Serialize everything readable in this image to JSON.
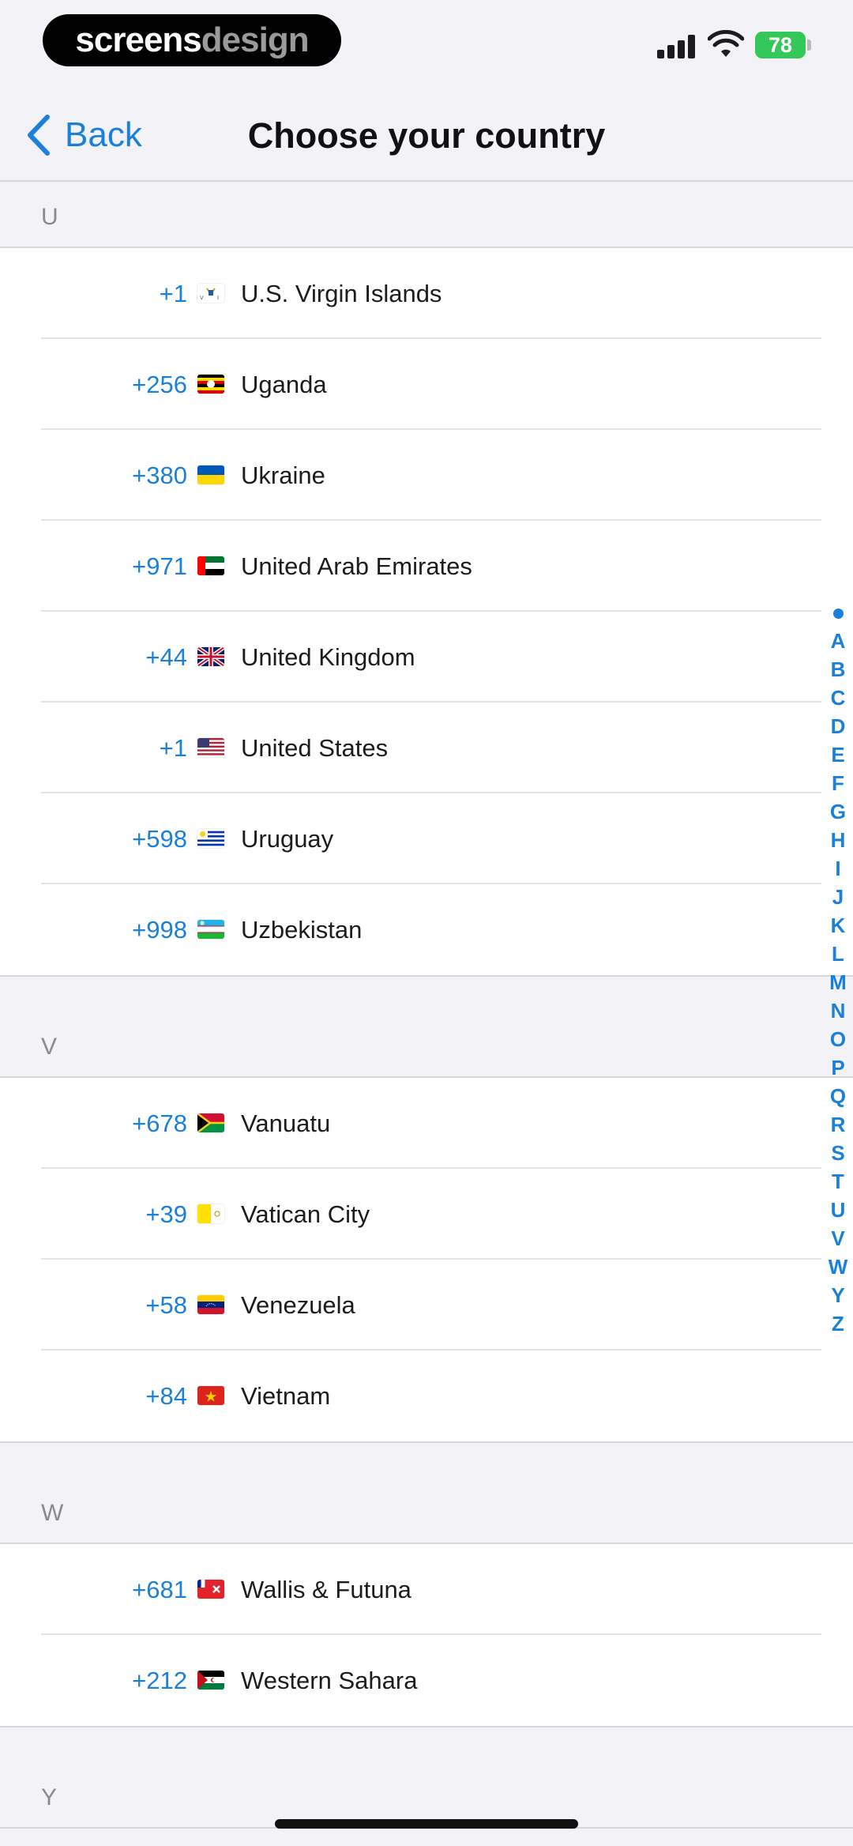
{
  "watermark": {
    "part1": "screens",
    "part2": "design"
  },
  "status": {
    "battery": "78"
  },
  "nav": {
    "back_label": "Back",
    "title": "Choose your country"
  },
  "colors": {
    "accent": "#1a80d9",
    "battery": "#34c759",
    "background": "#f2f2f7"
  },
  "sections": [
    {
      "letter": "U",
      "rows": [
        {
          "code": "+1",
          "name": "U.S. Virgin Islands",
          "flag": "flag-us-virgin-islands"
        },
        {
          "code": "+256",
          "name": "Uganda",
          "flag": "flag-uganda"
        },
        {
          "code": "+380",
          "name": "Ukraine",
          "flag": "flag-ukraine"
        },
        {
          "code": "+971",
          "name": "United Arab Emirates",
          "flag": "flag-uae"
        },
        {
          "code": "+44",
          "name": "United Kingdom",
          "flag": "flag-uk"
        },
        {
          "code": "+1",
          "name": "United States",
          "flag": "flag-us"
        },
        {
          "code": "+598",
          "name": "Uruguay",
          "flag": "flag-uruguay"
        },
        {
          "code": "+998",
          "name": "Uzbekistan",
          "flag": "flag-uzbekistan"
        }
      ]
    },
    {
      "letter": "V",
      "rows": [
        {
          "code": "+678",
          "name": "Vanuatu",
          "flag": "flag-vanuatu"
        },
        {
          "code": "+39",
          "name": "Vatican City",
          "flag": "flag-vatican"
        },
        {
          "code": "+58",
          "name": "Venezuela",
          "flag": "flag-venezuela"
        },
        {
          "code": "+84",
          "name": "Vietnam",
          "flag": "flag-vietnam"
        }
      ]
    },
    {
      "letter": "W",
      "rows": [
        {
          "code": "+681",
          "name": "Wallis & Futuna",
          "flag": "flag-wallis-futuna"
        },
        {
          "code": "+212",
          "name": "Western Sahara",
          "flag": "flag-western-sahara"
        }
      ]
    },
    {
      "letter": "Y",
      "rows": []
    }
  ],
  "alphabet": [
    "A",
    "B",
    "C",
    "D",
    "E",
    "F",
    "G",
    "H",
    "I",
    "J",
    "K",
    "L",
    "M",
    "N",
    "O",
    "P",
    "Q",
    "R",
    "S",
    "T",
    "U",
    "V",
    "W",
    "Y",
    "Z"
  ]
}
